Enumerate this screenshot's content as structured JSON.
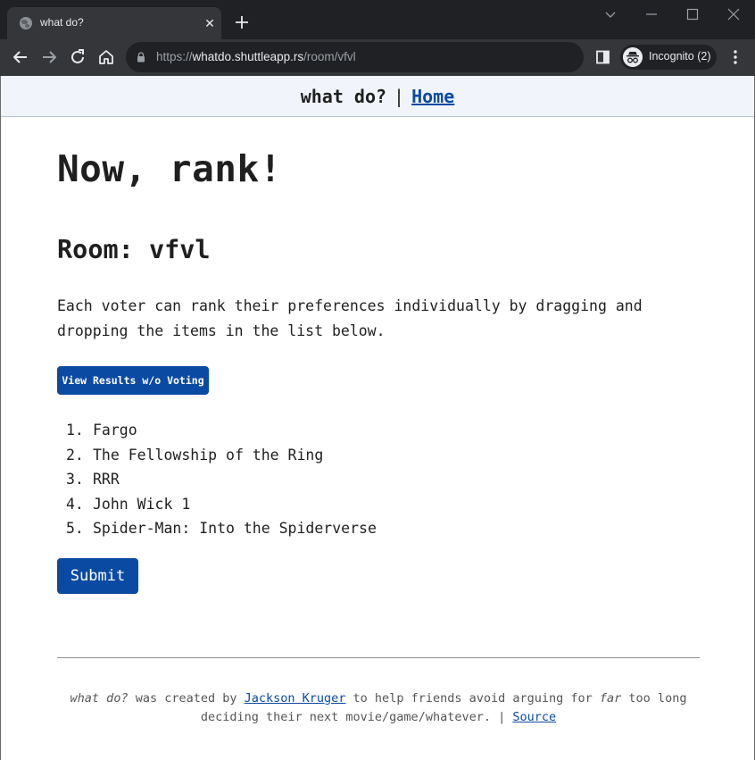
{
  "browser": {
    "tab_title": "what do?",
    "url_scheme": "https://",
    "url_host": "whatdo.shuttleapp.rs",
    "url_path": "/room/vfvl",
    "incognito_label": "Incognito (2)"
  },
  "header": {
    "brand": "what do?",
    "separator": "|",
    "home_link": "Home"
  },
  "main": {
    "heading": "Now, rank!",
    "room_label": "Room: vfvl",
    "instructions": "Each voter can rank their preferences individually by dragging and dropping the items in the list below.",
    "results_button": "View Results w/o Voting",
    "rank_items": [
      {
        "number": "1.",
        "label": "Fargo"
      },
      {
        "number": "2.",
        "label": "The Fellowship of the Ring"
      },
      {
        "number": "3.",
        "label": "RRR"
      },
      {
        "number": "4.",
        "label": "John Wick 1"
      },
      {
        "number": "5.",
        "label": "Spider-Man: Into the Spiderverse"
      }
    ],
    "submit_button": "Submit"
  },
  "footer": {
    "app_name": "what do?",
    "text_created_by": " was created by ",
    "author_link": "Jackson Kruger",
    "text_middle": " to help friends avoid arguing for ",
    "emphasis": "far",
    "text_end": " too long deciding their next movie/game/whatever. | ",
    "source_link": "Source"
  },
  "colors": {
    "accent": "#0b4aa2",
    "header_bg": "#f1f5fb",
    "chrome_dark": "#202124",
    "chrome_mid": "#35363a"
  }
}
